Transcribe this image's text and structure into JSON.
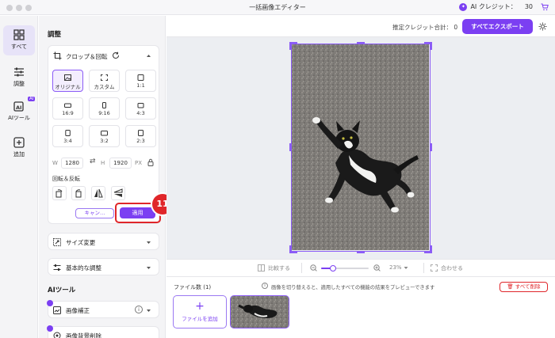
{
  "app": {
    "title": "一括画像エディター",
    "ai_credit_label": "AI クレジット：",
    "ai_credit_value": "30"
  },
  "nav": [
    {
      "label": "すべて",
      "icon": "grid-icon"
    },
    {
      "label": "調整",
      "icon": "sliders-icon"
    },
    {
      "label": "AIツール",
      "icon": "ai-icon",
      "badge": "AI"
    },
    {
      "label": "追加",
      "icon": "plus-square-icon"
    }
  ],
  "panel": {
    "section_adjust": "調整",
    "crop": {
      "title": "クロップ＆回転",
      "ratios": [
        {
          "label": "オリジナル",
          "selected": true
        },
        {
          "label": "カスタム"
        },
        {
          "label": "1:1"
        },
        {
          "label": "16:9"
        },
        {
          "label": "9:16"
        },
        {
          "label": "4:3"
        },
        {
          "label": "3:4"
        },
        {
          "label": "3:2"
        },
        {
          "label": "2:3"
        }
      ],
      "width_label": "W",
      "width_value": "1280",
      "height_label": "H",
      "height_value": "1920",
      "unit": "PX",
      "rotate_flip_label": "回転＆反転",
      "cancel_label": "キャン…",
      "apply_label": "適用"
    },
    "resize_label": "サイズ変更",
    "basic_adjust_label": "基本的な調整",
    "section_ai": "AIツール",
    "enhance_label": "画像補正",
    "bg_remove_label": "画像背景削除"
  },
  "annotation": {
    "step": "11"
  },
  "topbar": {
    "total_credit_label": "推定クレジット合計：",
    "total_credit_value": "0",
    "export_label": "すべてエクスポート"
  },
  "zoombar": {
    "compare_label": "比較する",
    "zoom_level": "23%",
    "fit_label": "合わせる",
    "zoom_fraction": 0.25
  },
  "files": {
    "count_label": "ファイル数 (1)",
    "info_text": "画像を切り替えると、適用したすべての機能の結果をプレビューできます",
    "delete_all_label": "すべて削除",
    "add_file_label": "ファイルを追加"
  },
  "colors": {
    "accent": "#7b3ff2",
    "annotation_red": "#e0262a"
  }
}
